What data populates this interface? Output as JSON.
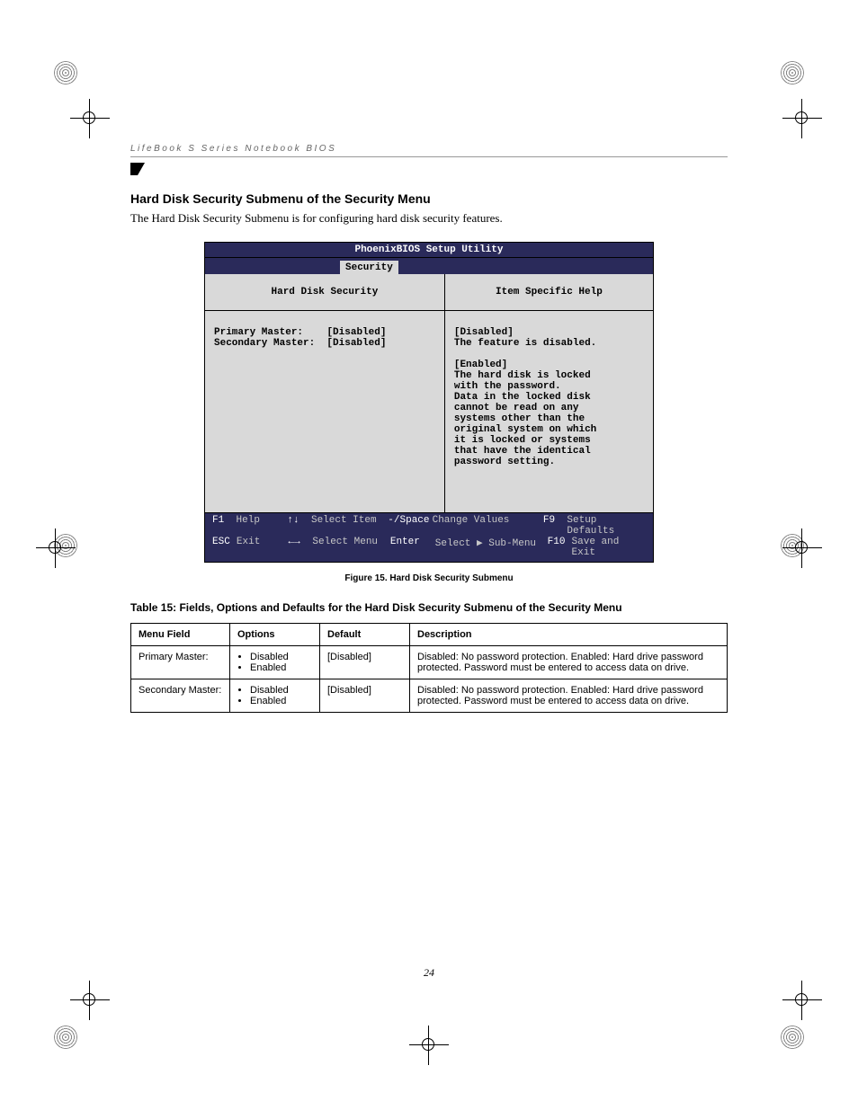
{
  "header": {
    "running_title": "LifeBook S Series Notebook BIOS"
  },
  "section": {
    "title": "Hard Disk Security Submenu of the Security Menu",
    "intro": "The Hard Disk Security Submenu is for configuring hard disk security features."
  },
  "bios": {
    "title": "PhoenixBIOS Setup Utility",
    "active_tab": "Security",
    "left_panel_title": "Hard Disk Security",
    "right_panel_title": "Item Specific Help",
    "fields": {
      "primary_label": "Primary Master:",
      "primary_value": "[Disabled]",
      "secondary_label": "Secondary Master:",
      "secondary_value": "[Disabled]"
    },
    "help_text": "[Disabled]\nThe feature is disabled.\n\n[Enabled]\nThe hard disk is locked\nwith the password.\nData in the locked disk\ncannot be read on any\nsystems other than the\noriginal system on which\nit is locked or systems\nthat have the identical\npassword setting.",
    "footer": {
      "row1": {
        "k1": "F1",
        "l1": "Help",
        "k2": "↑↓",
        "l2": "Select Item",
        "k3": "-/Space",
        "l3": "Change Values",
        "k4": "F9",
        "l4": "Setup Defaults"
      },
      "row2": {
        "k1": "ESC",
        "l1": "Exit",
        "k2": "←→",
        "l2": "Select Menu",
        "k3": "Enter",
        "l3": "Select ▶ Sub-Menu",
        "k4": "F10",
        "l4": "Save and Exit"
      }
    }
  },
  "figure_caption": "Figure 15.   Hard Disk Security Submenu",
  "table": {
    "title": "Table 15: Fields, Options and Defaults for the Hard Disk Security Submenu of the Security Menu",
    "headers": {
      "menu_field": "Menu Field",
      "options": "Options",
      "default": "Default",
      "description": "Description"
    },
    "rows": [
      {
        "menu_field": "Primary Master:",
        "options": [
          "Disabled",
          "Enabled"
        ],
        "default": "[Disabled]",
        "description": "Disabled: No password protection.\nEnabled: Hard drive password protected. Password must be entered to access data on drive."
      },
      {
        "menu_field": "Secondary Master:",
        "options": [
          "Disabled",
          "Enabled"
        ],
        "default": "[Disabled]",
        "description": "Disabled: No password protection.\nEnabled: Hard drive password protected. Password must be entered to access data on drive."
      }
    ]
  },
  "page_number": "24"
}
